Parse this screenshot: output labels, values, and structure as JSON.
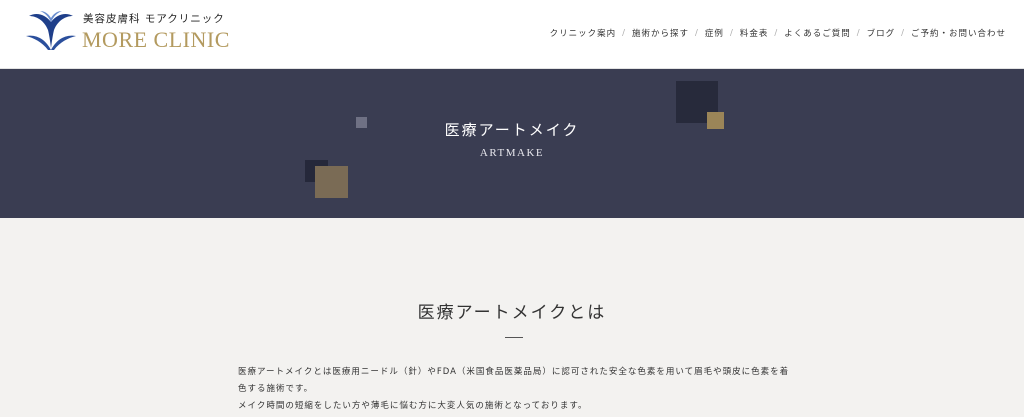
{
  "header": {
    "logo_sub": "美容皮膚科 モアクリニック",
    "logo_main": "MORE CLINIC",
    "brand_color": "#b39a5f",
    "nav": [
      {
        "label": "クリニック案内"
      },
      {
        "label": "施術から探す"
      },
      {
        "label": "症例"
      },
      {
        "label": "料金表"
      },
      {
        "label": "よくあるご質問"
      },
      {
        "label": "ブログ"
      },
      {
        "label": "ご予約・お問い合わせ"
      }
    ],
    "nav_separator": "/"
  },
  "hero": {
    "title": "医療アートメイク",
    "subtitle": "ARTMAKE",
    "background": "#3a3d52"
  },
  "main": {
    "section_title": "医療アートメイクとは",
    "paragraphs": [
      "医療アートメイクとは医療用ニードル（針）やFDA（米国食品医薬品局）に認可された安全な色素を用いて眉毛や頭皮に色素を着色する施術です。",
      "メイク時間の短縮をしたい方や薄毛に悩む方に大変人気の施術となっております。"
    ]
  }
}
